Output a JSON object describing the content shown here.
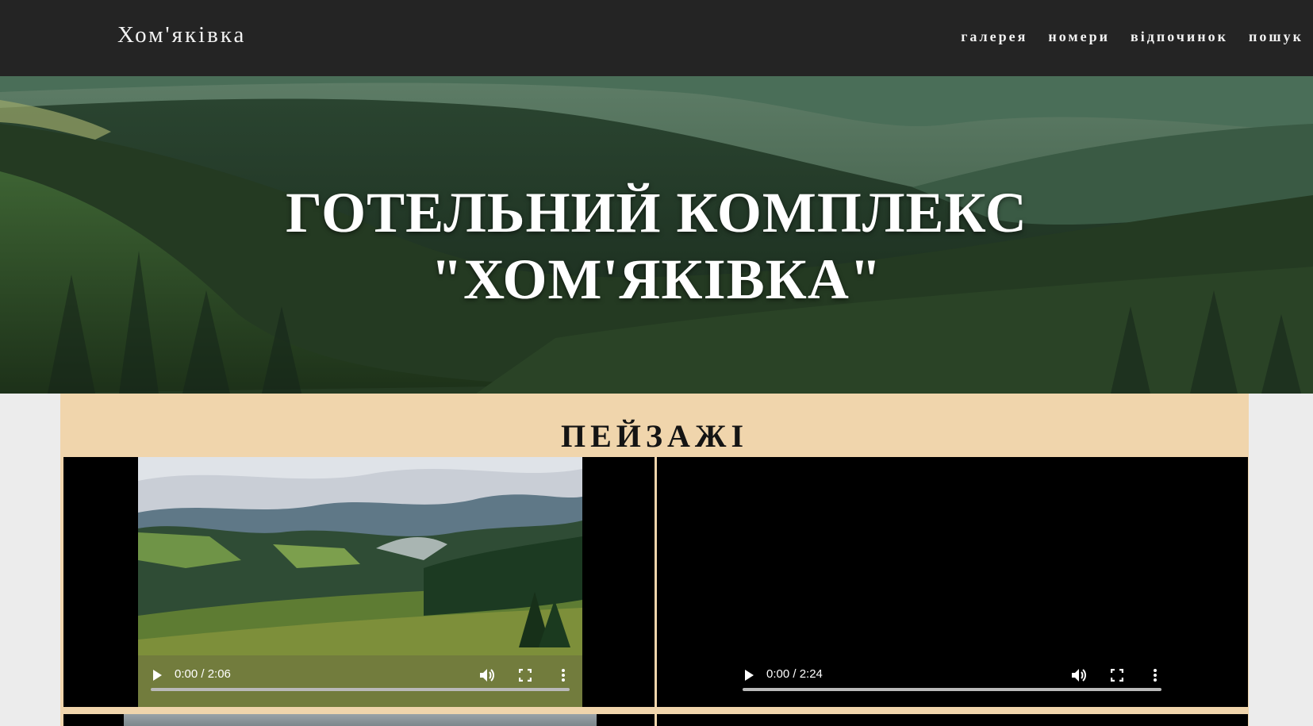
{
  "header": {
    "brand": "Хом'яківка",
    "nav": [
      "галерея",
      "номери",
      "відпочинок",
      "пошук"
    ]
  },
  "hero": {
    "title_line1": "ГОТЕЛЬНИЙ КОМПЛЕКС",
    "title_line2": "\"ХОМ'ЯКІВКА\""
  },
  "section": {
    "title": "ПЕЙЗАЖІ"
  },
  "videos": [
    {
      "time": "0:00 / 2:06",
      "progress": 0
    },
    {
      "time": "0:00 / 2:24",
      "progress": 0
    }
  ],
  "colors": {
    "header_bg": "#242424",
    "section_bg": "#f0d5ac",
    "page_bg": "#ececec"
  },
  "icons": [
    "play-icon",
    "volume-icon",
    "fullscreen-icon",
    "more-options-icon"
  ]
}
